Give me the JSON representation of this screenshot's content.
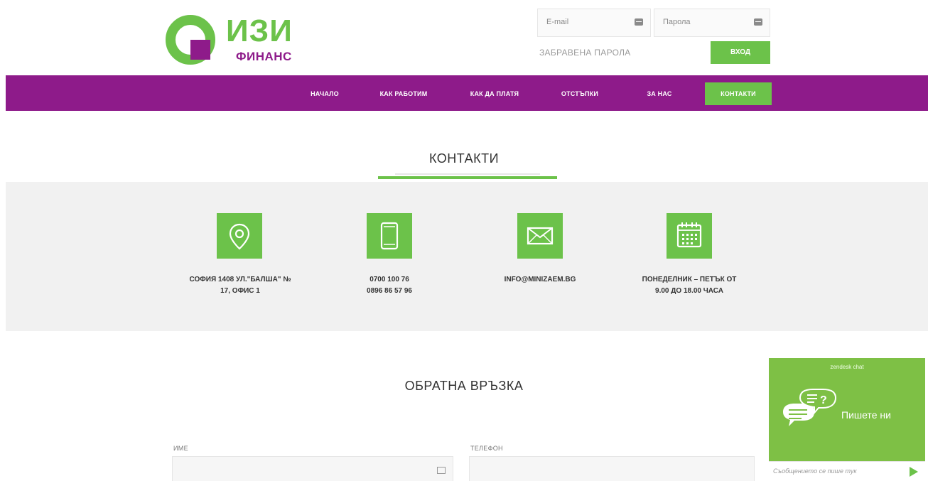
{
  "brand": {
    "name": "ИЗИ",
    "sub": "ФИНАНС",
    "green": "#6cc24a",
    "purple": "#8e1b8a"
  },
  "login": {
    "email_placeholder": "E-mail",
    "password_placeholder": "Парола",
    "forgot_label": "ЗАБРАВЕНА ПАРОЛА",
    "submit_label": "ВХОД"
  },
  "nav": {
    "items": [
      {
        "label": "НАЧАЛО"
      },
      {
        "label": "КАК РАБОТИМ"
      },
      {
        "label": "КАК ДА ПЛАТЯ"
      },
      {
        "label": "ОТСТЪПКИ"
      },
      {
        "label": "ЗА НАС"
      },
      {
        "label": "КОНТАКТИ",
        "active": true
      }
    ]
  },
  "contacts": {
    "title": "КОНТАКТИ",
    "items": [
      {
        "icon": "map-pin-icon",
        "line1": "СОФИЯ 1408 УЛ.\"БАЛША\" №",
        "line2": "17, ОФИС 1"
      },
      {
        "icon": "tablet-icon",
        "line1": "0700 100 76",
        "line2": "0896 86 57 96"
      },
      {
        "icon": "envelope-icon",
        "line1": "INFO@MINIZAEM.BG",
        "line2": ""
      },
      {
        "icon": "calendar-icon",
        "line1": "ПОНЕДЕЛНИК – ПЕТЪК ОТ",
        "line2": "9.00 ДО 18.00 ЧАСА"
      }
    ]
  },
  "feedback": {
    "title": "ОБРАТНА ВРЪЗКА",
    "name_label": "ИМЕ",
    "phone_label": "ТЕЛЕФОН"
  },
  "zendesk": {
    "brand": "zendesk chat",
    "cta": "Пишете ни",
    "placeholder": "Съобщението се пише тук"
  }
}
